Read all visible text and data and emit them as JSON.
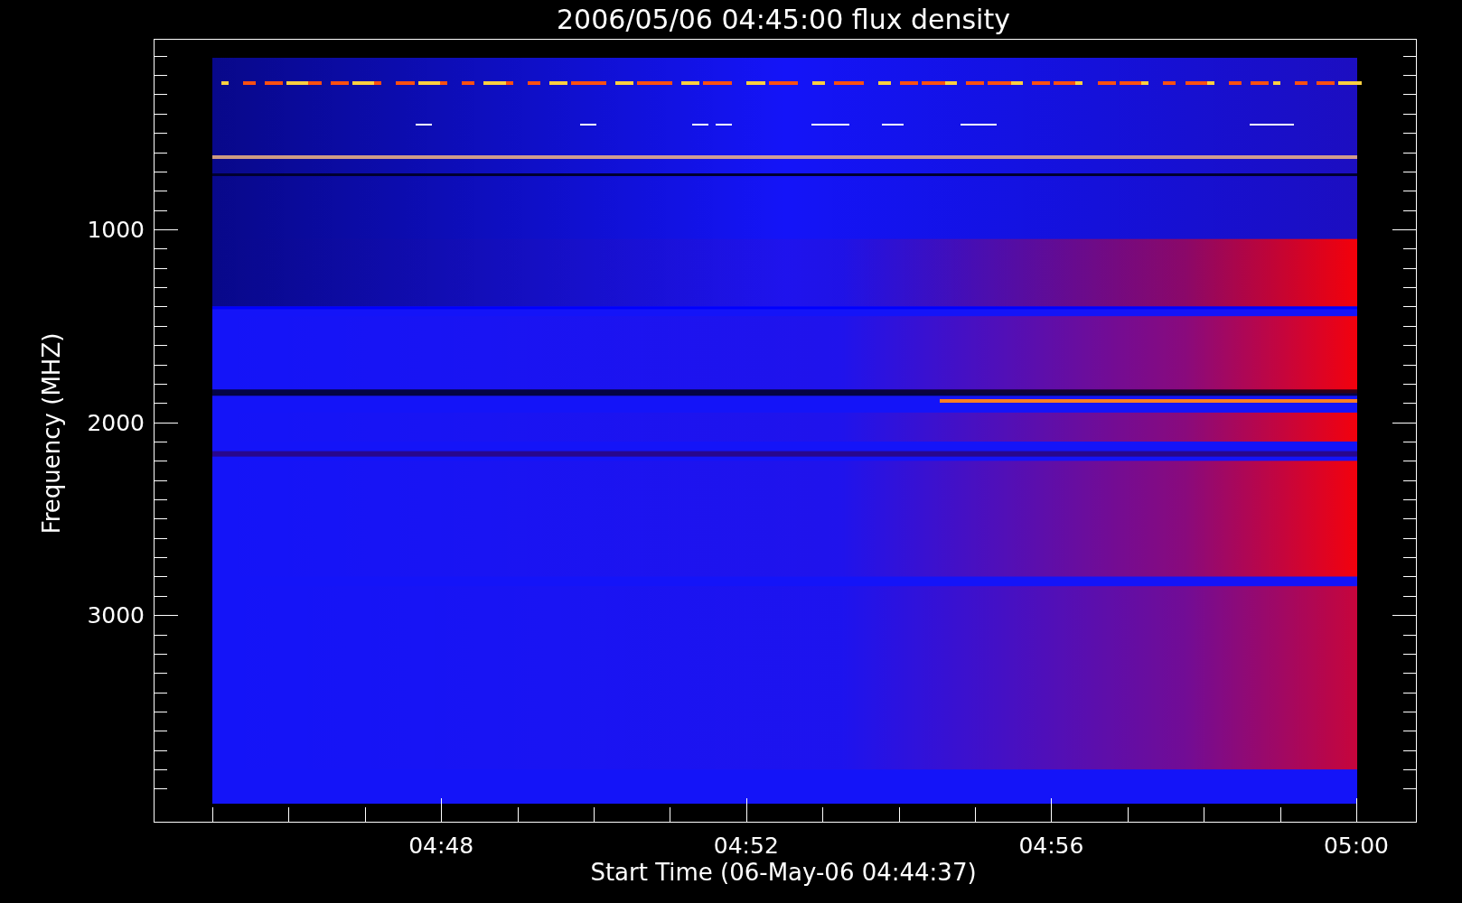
{
  "plot": {
    "title": "2006/05/06 04:45:00 flux density",
    "xlabel": "Start Time (06-May-06 04:44:37)",
    "ylabel": "Frequency (MHZ)",
    "xticks": [
      "04:48",
      "04:52",
      "04:56",
      "05:00"
    ],
    "yticks": [
      "1000",
      "2000",
      "3000"
    ]
  }
}
